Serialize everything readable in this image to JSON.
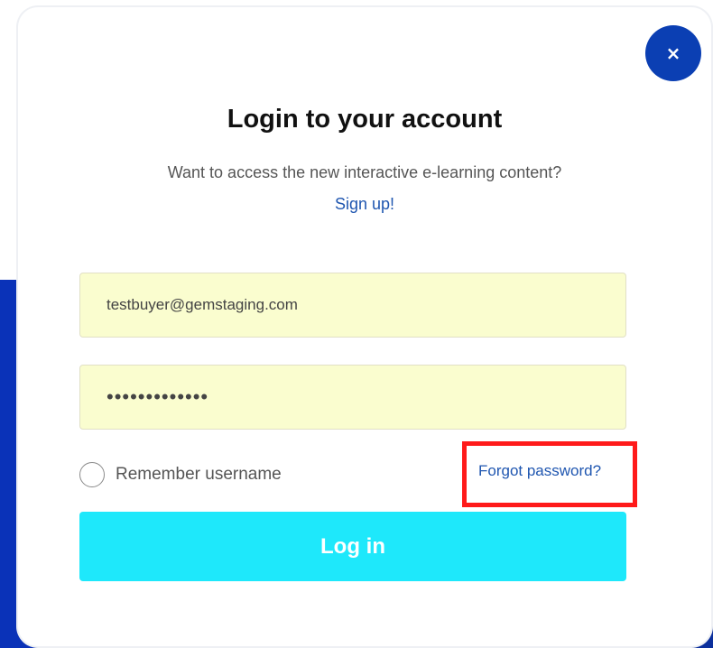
{
  "modal": {
    "close_icon": "×",
    "title": "Login to your account",
    "subtitle": "Want to access the new interactive e-learning content?",
    "signup_link": "Sign up!"
  },
  "form": {
    "email_value": "testbuyer@gemstaging.com",
    "password_masked": "•••••••••••••",
    "remember_label": "Remember username",
    "remember_checked": false,
    "forgot_link": "Forgot password?",
    "login_button": "Log in"
  },
  "colors": {
    "accent": "#1ee8fb",
    "close_button": "#0b3fb3",
    "link": "#1f56b0",
    "highlight": "#ff1a1a",
    "input_bg": "#fafdcf",
    "backdrop": "#0a32b8"
  }
}
